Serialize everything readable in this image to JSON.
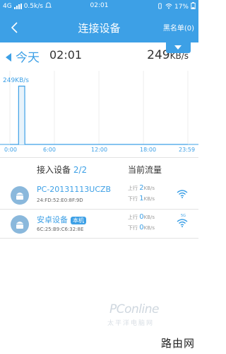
{
  "status_bar": {
    "network": "4G",
    "speed": "0.5k/s",
    "time": "02:01",
    "battery": "17%"
  },
  "nav": {
    "back_icon": "chevron-left-icon",
    "title": "连接设备",
    "blacklist": "黑名单(0)"
  },
  "header": {
    "day": "今天",
    "time": "02:01",
    "speed_value": "249",
    "speed_unit": "KB/s"
  },
  "chart_data": {
    "type": "line",
    "x_ticks": [
      "0:00",
      "6:00",
      "12:00",
      "18:00",
      "23:59"
    ],
    "peak_label": "249KB/s",
    "series": [
      {
        "x": [
          "0:00",
          "1:10",
          "1:11",
          "2:00",
          "2:01",
          "23:59"
        ],
        "values": [
          0,
          0,
          249,
          249,
          0,
          0
        ]
      }
    ],
    "ylim": [
      0,
      260
    ],
    "color": "#3da0e6"
  },
  "table": {
    "col_devices": "接入设备",
    "device_count": "2/2",
    "col_flow": "当前流量"
  },
  "devices": [
    {
      "name": "PC-20131113UCZB",
      "badge": "",
      "mac": "24:FD:52:E0:8F:9D",
      "up_label": "上行",
      "up_value": "2",
      "down_label": "下行",
      "down_value": "1",
      "unit": "KB/s",
      "band": ""
    },
    {
      "name": "安卓设备",
      "badge": "本机",
      "mac": "6C:25:B9:C6:32:8E",
      "up_label": "上行",
      "up_value": "0",
      "down_label": "下行",
      "down_value": "0",
      "unit": "KB/s",
      "band": "5G"
    }
  ],
  "watermark": {
    "logo": "PConline",
    "sub": "太平洋电脑网",
    "site": "路由网"
  },
  "colors": {
    "accent": "#3da0e6"
  }
}
